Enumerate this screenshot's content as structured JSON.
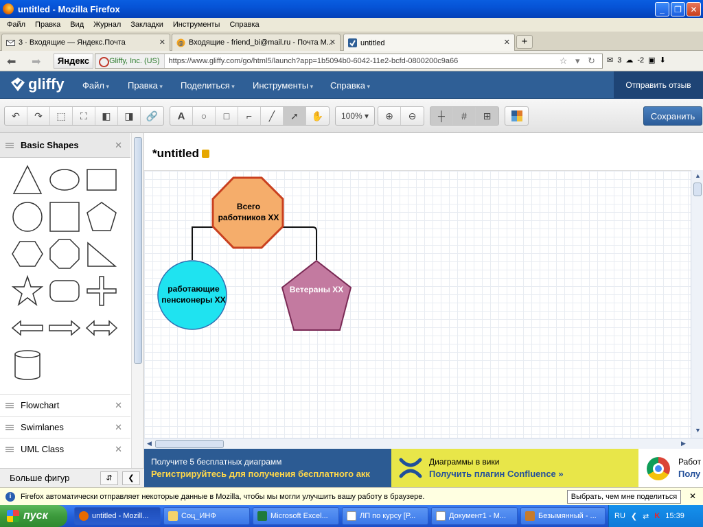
{
  "window": {
    "title": "untitled - Mozilla Firefox"
  },
  "menubar": [
    "Файл",
    "Правка",
    "Вид",
    "Журнал",
    "Закладки",
    "Инструменты",
    "Справка"
  ],
  "tabs": [
    {
      "label": "3 · Входящие — Яндекс.Почта"
    },
    {
      "label": "Входящие - friend_bi@mail.ru - Почта М..."
    },
    {
      "label": "untitled"
    }
  ],
  "navbar": {
    "yandex": "Яндекс",
    "site_identity": "Gliffy, Inc. (US)",
    "url": "https://www.gliffy.com/go/html5/launch?app=1b5094b0-6042-11e2-bcfd-0800200c9a66",
    "mail_count": "3",
    "weather": "-2"
  },
  "gliffy": {
    "logo": "gliffy",
    "menu": [
      "Файл",
      "Правка",
      "Поделиться",
      "Инструменты",
      "Справка"
    ],
    "feedback": "Отправить отзыв",
    "zoom": "100%",
    "save": "Сохранить",
    "doc_title": "*untitled"
  },
  "library": {
    "title": "Basic Shapes",
    "shapes": [
      "triangle",
      "ellipse",
      "rectangle",
      "circle",
      "square",
      "pentagon",
      "hexagon",
      "octagon",
      "right-triangle",
      "star",
      "rounded-rectangle",
      "cross",
      "arrow-left",
      "arrow-right",
      "arrow-both",
      "cylinder"
    ],
    "others": [
      "Flowchart",
      "Swimlanes",
      "UML Class"
    ],
    "more": "Больше фигур"
  },
  "diagram": {
    "nodes": [
      {
        "id": "total",
        "shape": "octagon",
        "label": "Всего работников XX",
        "fill": "#f5ad6b",
        "stroke": "#c9401f"
      },
      {
        "id": "pensioners",
        "shape": "circle",
        "label": "работающие пенсионеры XX",
        "fill": "#1fe3f0",
        "stroke": "#2f6fb0"
      },
      {
        "id": "veterans",
        "shape": "pentagon",
        "label": "Ветераны XX",
        "fill": "#c37aa0",
        "stroke": "#7a2a55",
        "label_color": "#ffffff"
      }
    ]
  },
  "banners": [
    {
      "line1": "Получите 5 бесплатных диаграмм",
      "line2": "Регистрируйтесь для получения бесплатного акк"
    },
    {
      "line1": "Диаграммы в вики",
      "line2": "Получить плагин Confluence  »"
    },
    {
      "line1": "Работ",
      "line2": "Полу"
    }
  ],
  "notification": {
    "text": "Firefox автоматически отправляет некоторые данные в Mozilla, чтобы мы могли улучшить вашу работу в браузере.",
    "button": "Выбрать, чем мне поделиться"
  },
  "taskbar": {
    "start": "пуск",
    "tasks": [
      "untitled - Mozill...",
      "Соц_ИНФ",
      "Microsoft Excel...",
      "ЛП по курсу [Р...",
      "Документ1 - М...",
      "Безымянный - ..."
    ],
    "lang": "RU",
    "time": "15:39"
  }
}
